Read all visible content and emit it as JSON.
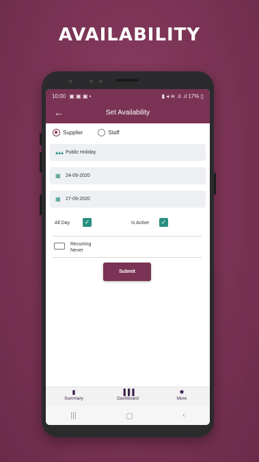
{
  "headline": "AVAILABILITY",
  "status_bar": {
    "time": "10:00",
    "left_icons": "▣ ▣ ▣ •",
    "battery": "17%"
  },
  "app_bar": {
    "title": "Set Availability"
  },
  "form": {
    "type_options": [
      {
        "label": "Supplier",
        "selected": true
      },
      {
        "label": "Staff",
        "selected": false
      }
    ],
    "category_value": "Public Holiday",
    "start_date_value": "24-09-2020",
    "end_date_value": "27-09-2020",
    "all_day_label": "All Day",
    "all_day_checked": true,
    "is_active_label": "Is Active",
    "is_active_checked": true,
    "recurring_label": "Recurring",
    "recurring_value": "Never",
    "submit_label": "Submit"
  },
  "bottom_nav": [
    {
      "label": "Summary",
      "icon": "book-icon"
    },
    {
      "label": "Dashboard",
      "icon": "bar-chart-icon"
    },
    {
      "label": "More",
      "icon": "gear-icon"
    }
  ],
  "colors": {
    "primary": "#7a3354",
    "accent": "#2a8f80",
    "background": "#7a3354"
  }
}
